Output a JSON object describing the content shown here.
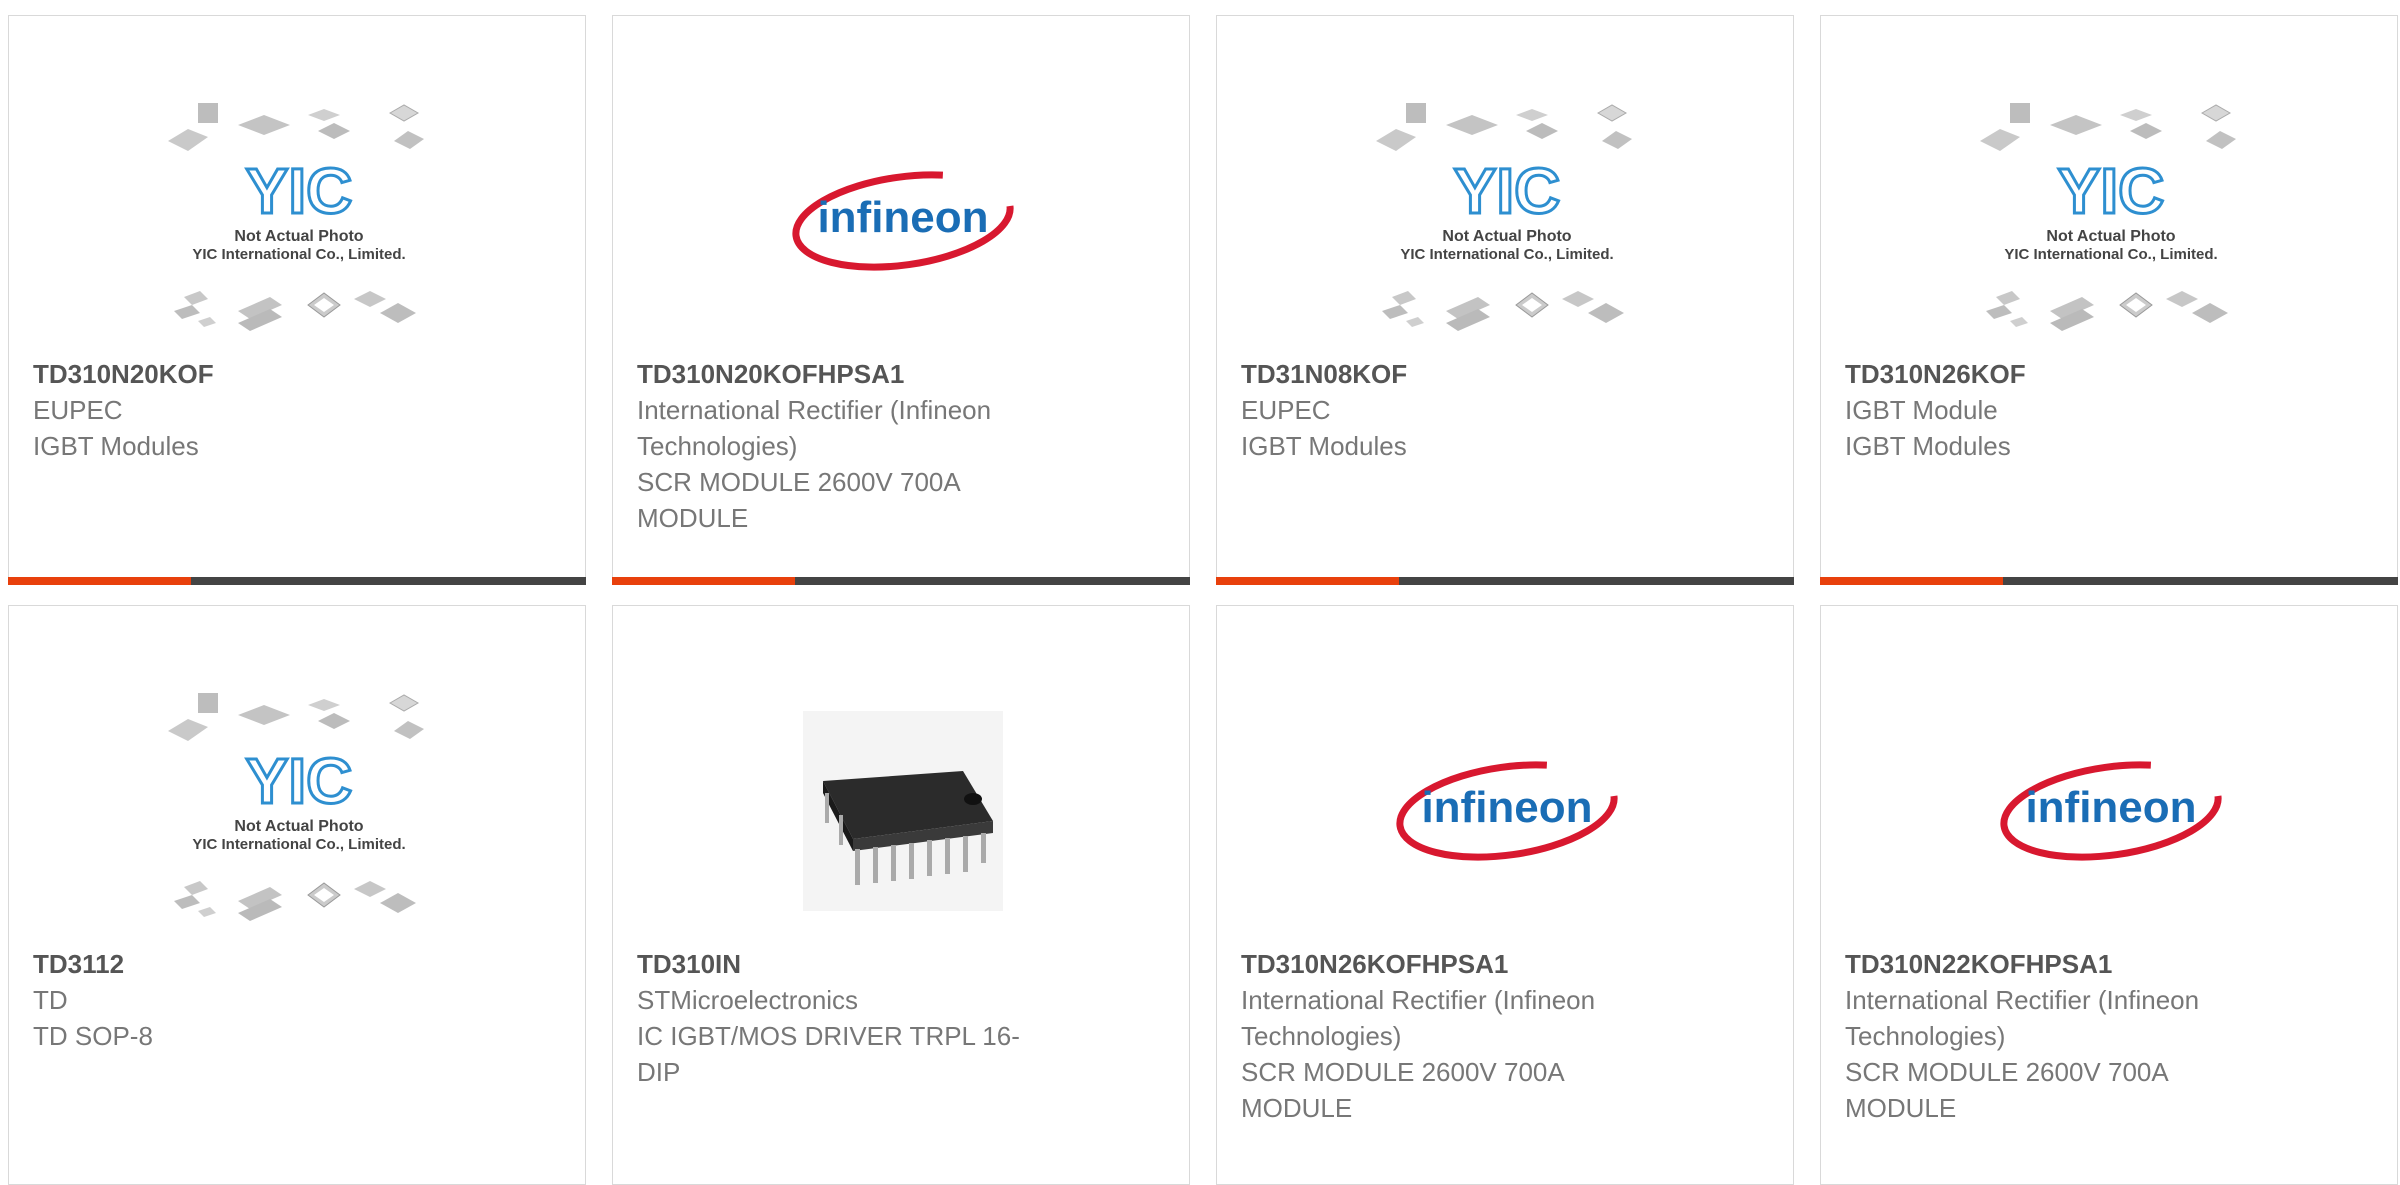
{
  "colors": {
    "accent": "#e8400c",
    "bar": "#444444",
    "infineon_blue": "#1a6db5",
    "infineon_red": "#d8182f",
    "yic_blue": "#2e8fd0"
  },
  "placeholder": {
    "line1": "Not Actual Photo",
    "line2": "YIC International Co., Limited."
  },
  "infineon_logo": "infineon",
  "products": [
    {
      "part": "TD310N20KOF",
      "maker": "EUPEC",
      "desc": "IGBT Modules",
      "image": "yic-placeholder-image"
    },
    {
      "part": "TD310N20KOFHPSA1",
      "maker": "International Rectifier (Infineon Technologies)",
      "desc": "SCR MODULE 2600V 700A MODULE",
      "image": "infineon-logo"
    },
    {
      "part": "TD31N08KOF",
      "maker": "EUPEC",
      "desc": "IGBT Modules",
      "image": "yic-placeholder-image"
    },
    {
      "part": "TD310N26KOF",
      "maker": "IGBT Module",
      "desc": "IGBT Modules",
      "image": "yic-placeholder-image"
    },
    {
      "part": "TD3112",
      "maker": "TD",
      "desc": "TD SOP-8",
      "image": "yic-placeholder-image"
    },
    {
      "part": "TD310IN",
      "maker": "STMicroelectronics",
      "desc": "IC IGBT/MOS DRIVER TRPL 16-DIP",
      "image": "dip-chip-photo"
    },
    {
      "part": "TD310N26KOFHPSA1",
      "maker": "International Rectifier (Infineon Technologies)",
      "desc": "SCR MODULE 2600V 700A MODULE",
      "image": "infineon-logo"
    },
    {
      "part": "TD310N22KOFHPSA1",
      "maker": "International Rectifier (Infineon Technologies)",
      "desc": "SCR MODULE 2600V 700A MODULE",
      "image": "infineon-logo"
    }
  ]
}
